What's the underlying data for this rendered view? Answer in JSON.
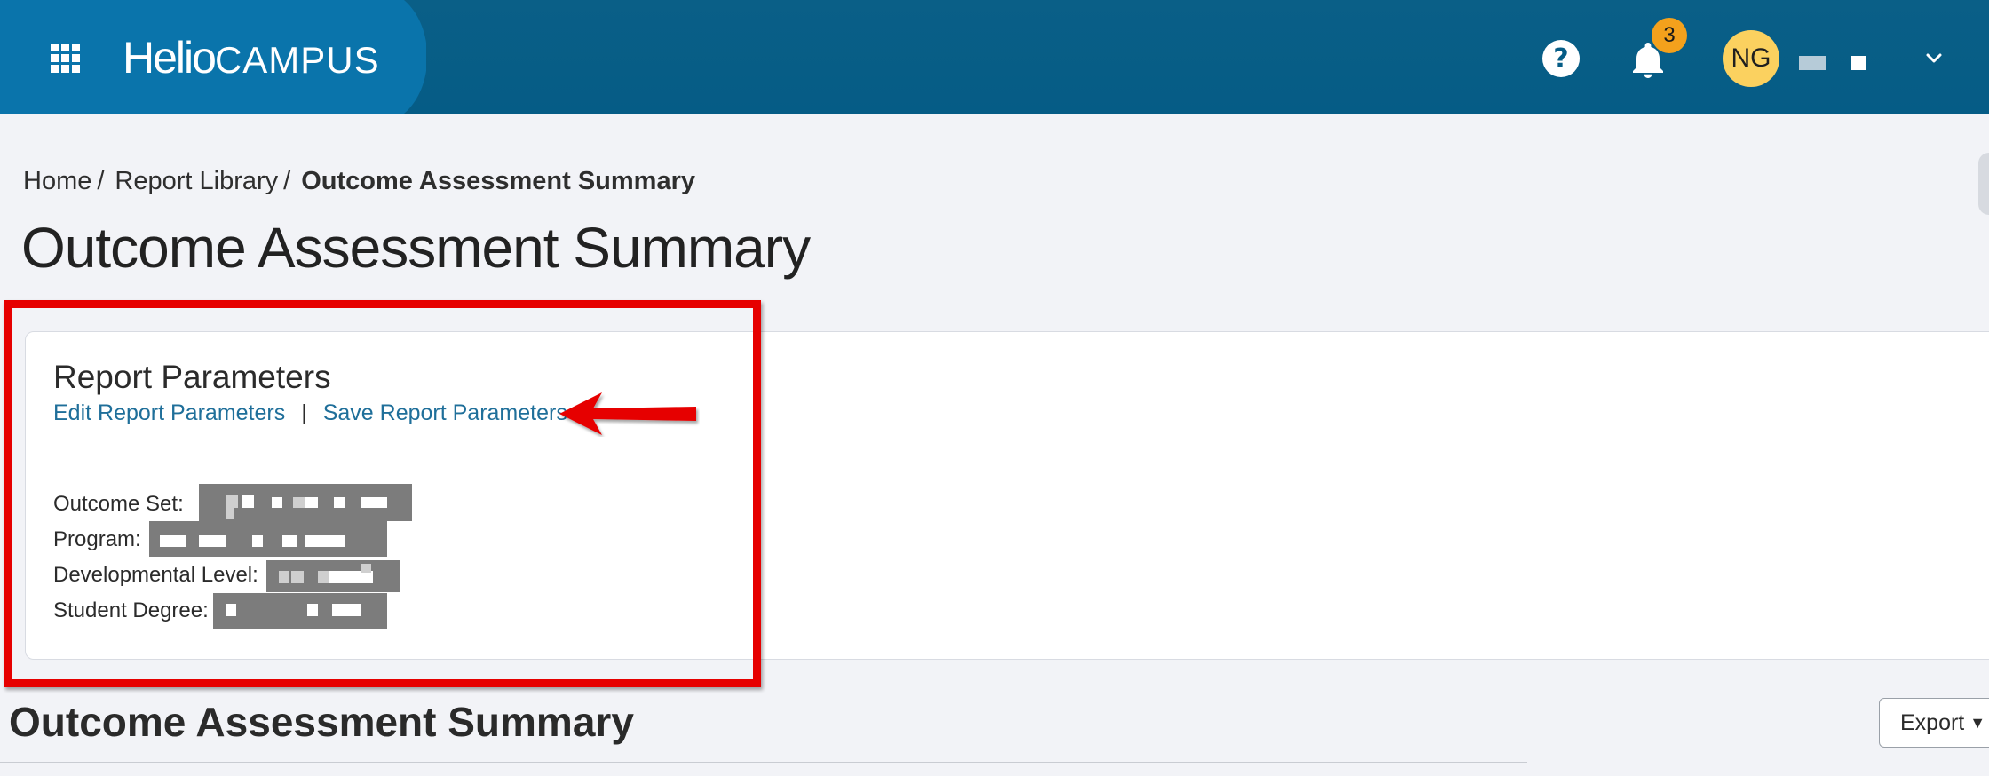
{
  "header": {
    "logo_primary": "Helio",
    "logo_secondary": "CAMPUS",
    "help_label": "?",
    "notification_count": "3",
    "avatar_initials": "NG"
  },
  "breadcrumb": {
    "items": [
      "Home",
      "Report Library"
    ],
    "separator": "/",
    "current": "Outcome Assessment Summary"
  },
  "page": {
    "title": "Outcome Assessment Summary"
  },
  "report_parameters": {
    "title": "Report Parameters",
    "edit_link": "Edit Report Parameters",
    "link_separator": "|",
    "save_link": "Save Report Parameters",
    "rows": [
      {
        "label": "Outcome Set:"
      },
      {
        "label": "Program:"
      },
      {
        "label": "Developmental Level:"
      },
      {
        "label": "Student Degree:"
      }
    ]
  },
  "summary_section": {
    "title": "Outcome Assessment Summary",
    "export_label": "Export"
  },
  "colors": {
    "header_bg": "#055c86",
    "header_accent": "#0a74ab",
    "link": "#1f6f9a",
    "badge": "#f4a11c",
    "avatar": "#fbd15f",
    "annotation": "#e60000"
  }
}
